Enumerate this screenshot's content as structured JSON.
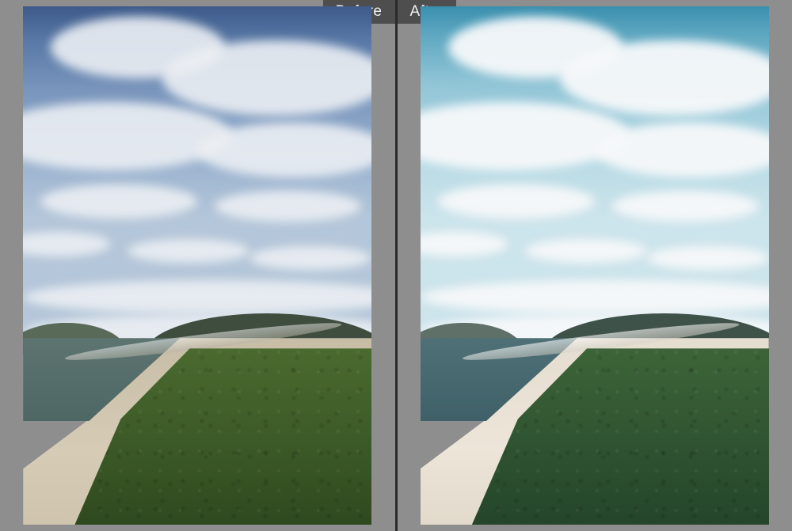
{
  "compare": {
    "before_label": "Before",
    "after_label": "After"
  }
}
